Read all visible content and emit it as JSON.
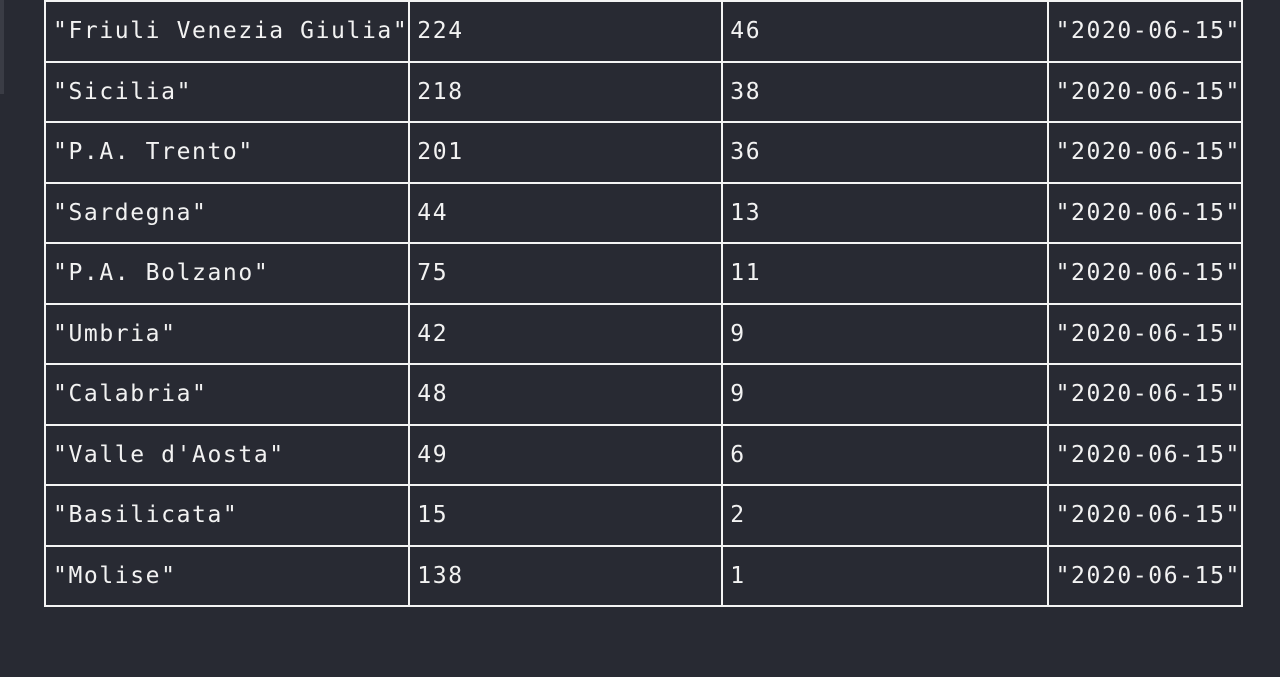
{
  "table": {
    "rows": [
      {
        "region": "\"Friuli Venezia Giulia\"",
        "value_a": "224",
        "value_b": "46",
        "date": "\"2020-06-15\""
      },
      {
        "region": "\"Sicilia\"",
        "value_a": "218",
        "value_b": "38",
        "date": "\"2020-06-15\""
      },
      {
        "region": "\"P.A. Trento\"",
        "value_a": "201",
        "value_b": "36",
        "date": "\"2020-06-15\""
      },
      {
        "region": "\"Sardegna\"",
        "value_a": "44",
        "value_b": "13",
        "date": "\"2020-06-15\""
      },
      {
        "region": "\"P.A. Bolzano\"",
        "value_a": "75",
        "value_b": "11",
        "date": "\"2020-06-15\""
      },
      {
        "region": "\"Umbria\"",
        "value_a": "42",
        "value_b": "9",
        "date": "\"2020-06-15\""
      },
      {
        "region": "\"Calabria\"",
        "value_a": "48",
        "value_b": "9",
        "date": "\"2020-06-15\""
      },
      {
        "region": "\"Valle d'Aosta\"",
        "value_a": "49",
        "value_b": "6",
        "date": "\"2020-06-15\""
      },
      {
        "region": "\"Basilicata\"",
        "value_a": "15",
        "value_b": "2",
        "date": "\"2020-06-15\""
      },
      {
        "region": "\"Molise\"",
        "value_a": "138",
        "value_b": "1",
        "date": "\"2020-06-15\""
      }
    ]
  }
}
